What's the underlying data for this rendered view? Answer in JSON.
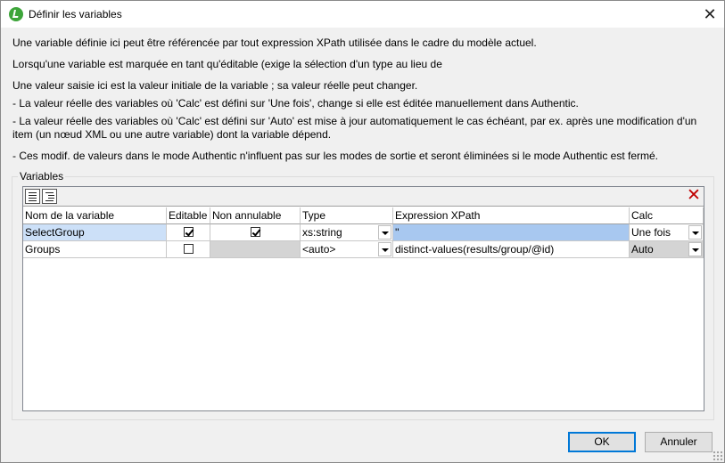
{
  "window": {
    "title": "Définir les variables",
    "close_glyph": "✕"
  },
  "description": {
    "line1": "Une variable définie ici peut être référencée par tout expression XPath utilisée dans le cadre du modèle actuel.",
    "line2": "Lorsqu'une variable est marquée en tant qu'éditable (exige la sélection d'un type au lieu de",
    "line3": "Une valeur saisie ici est la valeur initiale de la variable ; sa valeur réelle peut changer.",
    "line4": "- La valeur réelle des variables où 'Calc' est défini sur 'Une fois', change si elle est éditée manuellement dans Authentic.",
    "line5": "- La valeur réelle des variables où 'Calc' est défini sur 'Auto' est mise à jour automatiquement le cas échéant, par ex. après une modification d'un item (un nœud XML ou une autre variable) dont la variable dépend.",
    "line6": "- Ces modif. de valeurs dans le mode Authentic n'influent pas sur les modes de sortie et seront éliminées si le mode Authentic est fermé."
  },
  "variables_group": {
    "legend": "Variables",
    "delete_glyph": "✕",
    "columns": {
      "name": "Nom de la variable",
      "editable": "Editable",
      "non_cancelable": "Non annulable",
      "type": "Type",
      "xpath": "Expression XPath",
      "calc": "Calc"
    },
    "rows": [
      {
        "name": "SelectGroup",
        "editable": true,
        "non_cancelable": true,
        "type": "xs:string",
        "xpath": "''",
        "calc": "Une fois"
      },
      {
        "name": "Groups",
        "editable": false,
        "non_cancelable": null,
        "type": "<auto>",
        "xpath": "distinct-values(results/group/@id)",
        "calc": "Auto"
      }
    ]
  },
  "buttons": {
    "ok": "OK",
    "cancel": "Annuler"
  },
  "colors": {
    "selection": "#a8c8f0",
    "readonly_cell": "#d4d4d4",
    "delete_icon": "#c00000",
    "app_icon": "#3da53a"
  }
}
